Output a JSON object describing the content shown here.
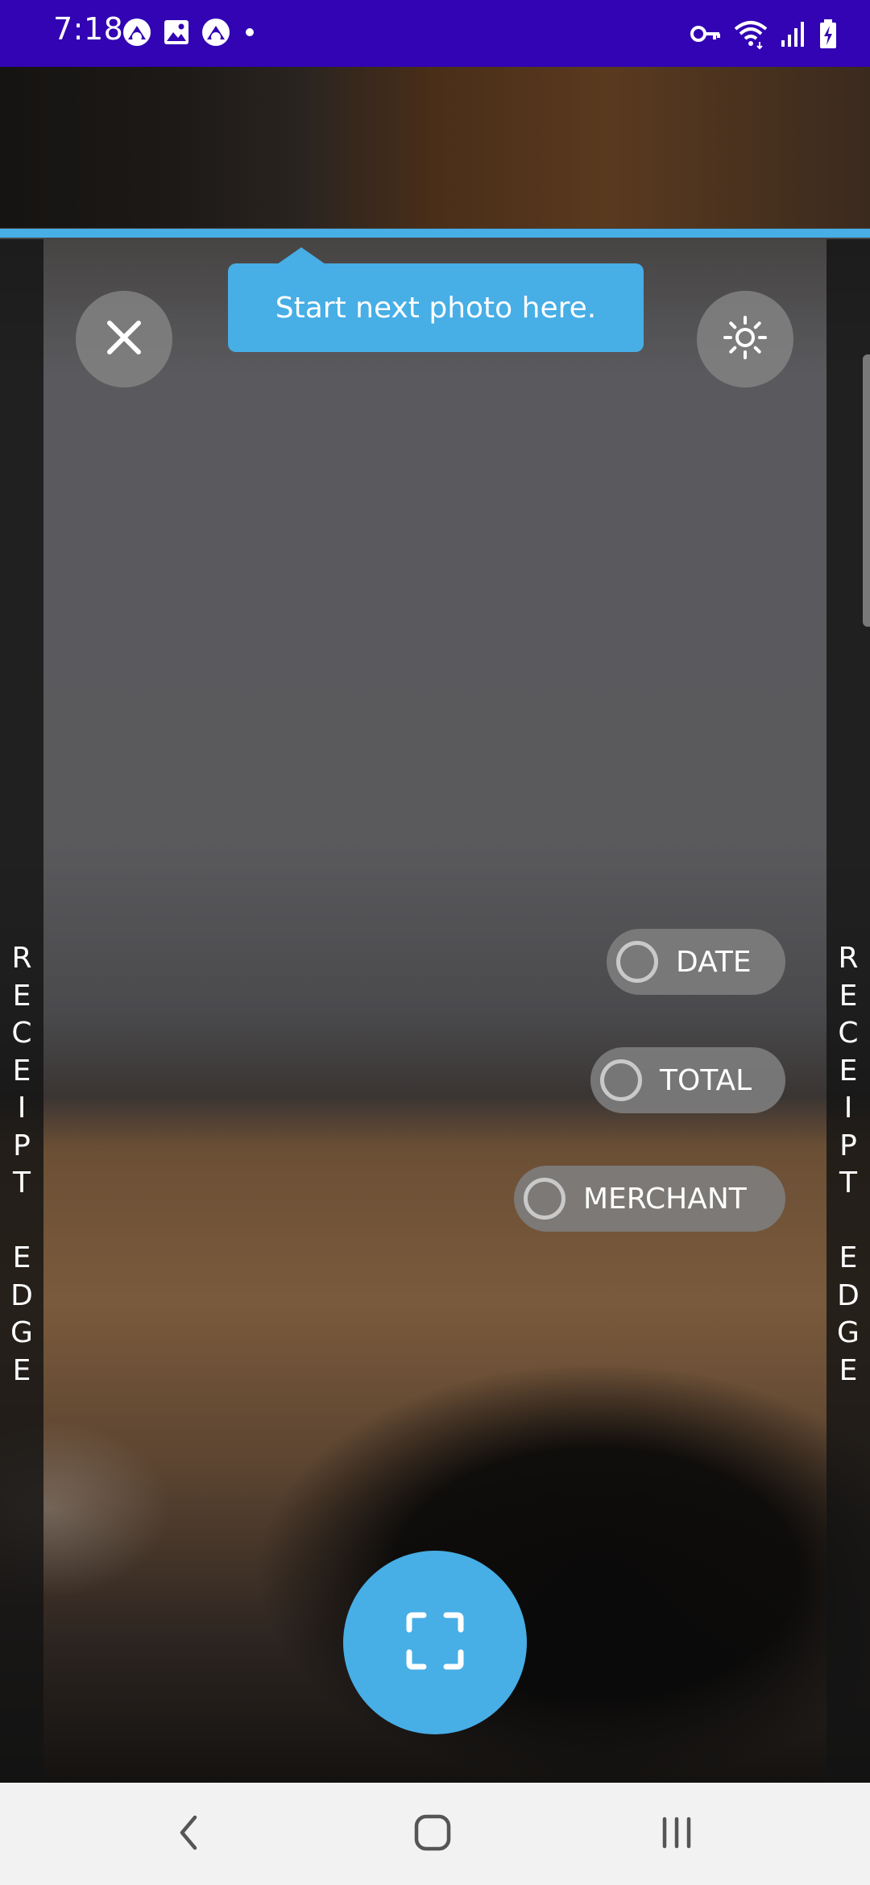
{
  "status_bar": {
    "time": "7:18",
    "background_color": "#3204b3",
    "left_icons": [
      "app-notification-icon",
      "gallery-icon",
      "app-notification-icon",
      "dot-icon"
    ],
    "right_icons": [
      "vpn-key-icon",
      "wifi-icon",
      "signal-icon",
      "battery-charging-icon"
    ]
  },
  "camera": {
    "guide_tooltip": "Start next photo here.",
    "accent_color": "#47aee6",
    "edge_label_left": "RECEIPT EDGE",
    "edge_label_right": "RECEIPT EDGE",
    "close_button_icon": "close-icon",
    "flash_button_icon": "brightness-icon",
    "capture_button_icon": "scan-frame-icon"
  },
  "fields": [
    {
      "label": "DATE",
      "selected": false
    },
    {
      "label": "TOTAL",
      "selected": false
    },
    {
      "label": "MERCHANT",
      "selected": false
    }
  ],
  "nav_bar": {
    "buttons": [
      "back-icon",
      "home-icon",
      "recents-icon"
    ]
  }
}
